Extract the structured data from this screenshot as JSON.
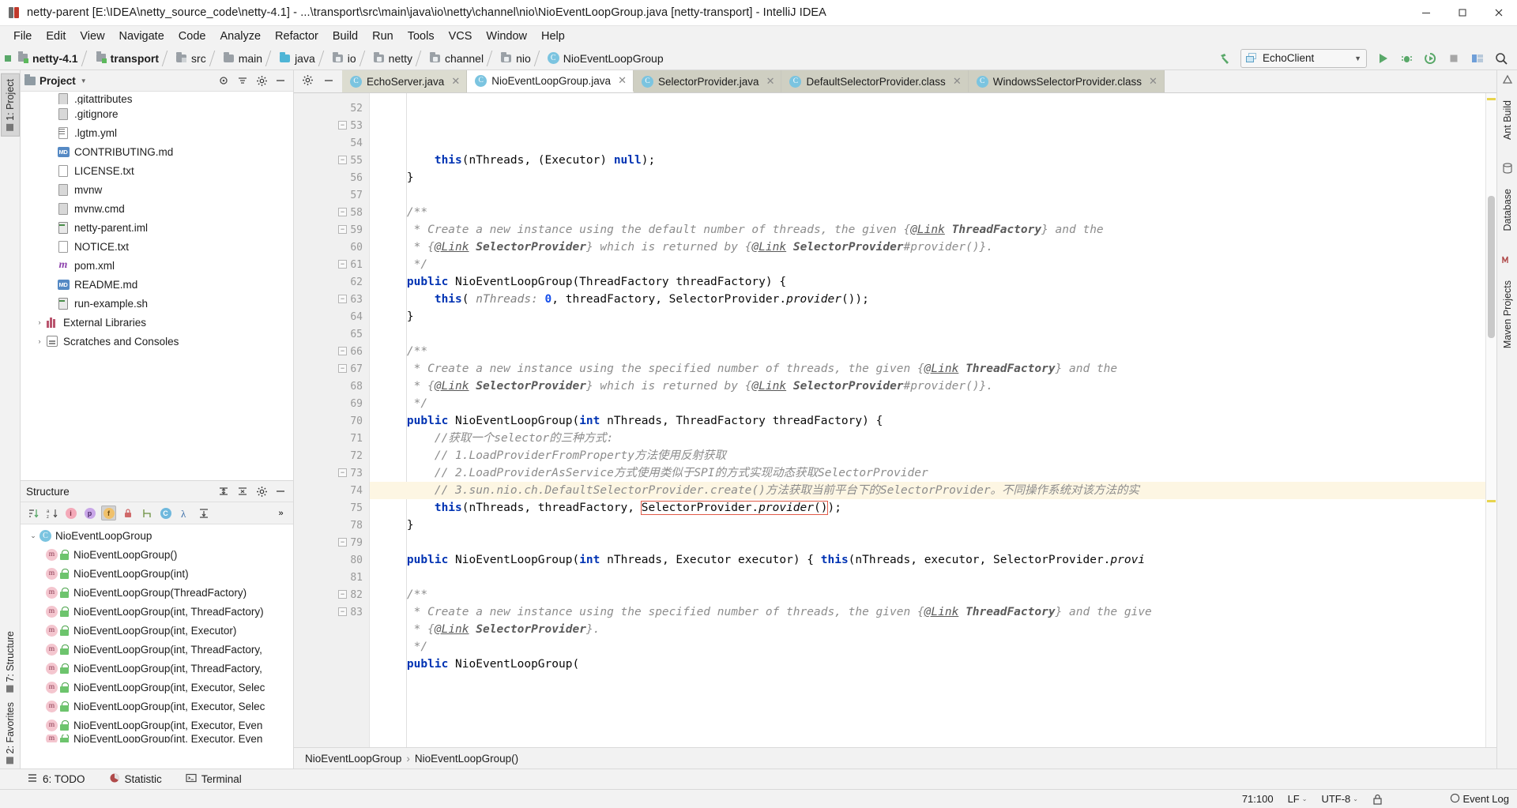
{
  "window": {
    "title": "netty-parent [E:\\IDEA\\netty_source_code\\netty-4.1] - ...\\transport\\src\\main\\java\\io\\netty\\channel\\nio\\NioEventLoopGroup.java [netty-transport] - IntelliJ IDEA",
    "minimize": "minimize-button",
    "maximize": "maximize-button",
    "close": "close-button"
  },
  "menu": [
    "File",
    "Edit",
    "View",
    "Navigate",
    "Code",
    "Analyze",
    "Refactor",
    "Build",
    "Run",
    "Tools",
    "VCS",
    "Window",
    "Help"
  ],
  "breadcrumbs": [
    {
      "label": "netty-4.1",
      "icon": "module-icon",
      "bold": true
    },
    {
      "label": "transport",
      "icon": "module-icon",
      "bold": true
    },
    {
      "label": "src",
      "icon": "folder-src-icon",
      "bold": false
    },
    {
      "label": "main",
      "icon": "folder-icon",
      "bold": false
    },
    {
      "label": "java",
      "icon": "folder-source-root-icon",
      "bold": false
    },
    {
      "label": "io",
      "icon": "folder-package-icon",
      "bold": false
    },
    {
      "label": "netty",
      "icon": "folder-package-icon",
      "bold": false
    },
    {
      "label": "channel",
      "icon": "folder-package-icon",
      "bold": false
    },
    {
      "label": "nio",
      "icon": "folder-package-icon",
      "bold": false
    },
    {
      "label": "NioEventLoopGroup",
      "icon": "class-icon",
      "bold": false
    }
  ],
  "toolbar": {
    "build_hammer": "build-icon",
    "run_config": "EchoClient",
    "run": "run-icon",
    "debug": "debug-icon",
    "run_coverage": "run-with-coverage-icon",
    "stop": "stop-icon",
    "layout": "layout-icon",
    "search": "search-everywhere-icon"
  },
  "project_panel": {
    "title": "Project",
    "collapse_icon": "collapse-all-icon",
    "settings_icon": "gear-icon",
    "hide_icon": "hide-icon",
    "items": [
      {
        "label": ".gitattributes",
        "icon": "file-icon",
        "indent": 1,
        "arrow": ""
      },
      {
        "label": ".gitignore",
        "icon": "file-icon",
        "indent": 1,
        "arrow": ""
      },
      {
        "label": ".lgtm.yml",
        "icon": "yaml-file-icon",
        "indent": 1,
        "arrow": ""
      },
      {
        "label": "CONTRIBUTING.md",
        "icon": "markdown-file-icon",
        "indent": 1,
        "arrow": ""
      },
      {
        "label": "LICENSE.txt",
        "icon": "text-file-icon",
        "indent": 1,
        "arrow": ""
      },
      {
        "label": "mvnw",
        "icon": "file-icon",
        "indent": 1,
        "arrow": ""
      },
      {
        "label": "mvnw.cmd",
        "icon": "file-icon",
        "indent": 1,
        "arrow": ""
      },
      {
        "label": "netty-parent.iml",
        "icon": "iml-file-icon",
        "indent": 1,
        "arrow": ""
      },
      {
        "label": "NOTICE.txt",
        "icon": "text-file-icon",
        "indent": 1,
        "arrow": ""
      },
      {
        "label": "pom.xml",
        "icon": "xml-file-icon",
        "indent": 1,
        "arrow": ""
      },
      {
        "label": "README.md",
        "icon": "markdown-file-icon",
        "indent": 1,
        "arrow": ""
      },
      {
        "label": "run-example.sh",
        "icon": "shell-file-icon",
        "indent": 1,
        "arrow": ""
      },
      {
        "label": "External Libraries",
        "icon": "libraries-icon",
        "indent": 0,
        "arrow": "›"
      },
      {
        "label": "Scratches and Consoles",
        "icon": "scratches-icon",
        "indent": 0,
        "arrow": "›"
      }
    ]
  },
  "structure_panel": {
    "title": "Structure",
    "toolbar_icons": [
      "sort-by-visibility-icon",
      "sort-alphabetically-icon",
      "show-inherited-icon",
      "show-properties-icon",
      "show-fields-icon",
      "show-non-public-icon",
      "group-by-icon",
      "show-anonymous-icon",
      "show-lambdas-icon",
      "expand-all-icon",
      "more-icon"
    ],
    "items": [
      {
        "label": "NioEventLoopGroup",
        "kind": "class",
        "indent": 0,
        "arrow": "⌄"
      },
      {
        "label": "NioEventLoopGroup()",
        "kind": "method",
        "indent": 1,
        "arrow": ""
      },
      {
        "label": "NioEventLoopGroup(int)",
        "kind": "method",
        "indent": 1,
        "arrow": ""
      },
      {
        "label": "NioEventLoopGroup(ThreadFactory)",
        "kind": "method",
        "indent": 1,
        "arrow": ""
      },
      {
        "label": "NioEventLoopGroup(int, ThreadFactory)",
        "kind": "method",
        "indent": 1,
        "arrow": ""
      },
      {
        "label": "NioEventLoopGroup(int, Executor)",
        "kind": "method",
        "indent": 1,
        "arrow": ""
      },
      {
        "label": "NioEventLoopGroup(int, ThreadFactory,",
        "kind": "method",
        "indent": 1,
        "arrow": ""
      },
      {
        "label": "NioEventLoopGroup(int, ThreadFactory,",
        "kind": "method",
        "indent": 1,
        "arrow": ""
      },
      {
        "label": "NioEventLoopGroup(int, Executor, Selec",
        "kind": "method",
        "indent": 1,
        "arrow": ""
      },
      {
        "label": "NioEventLoopGroup(int, Executor, Selec",
        "kind": "method",
        "indent": 1,
        "arrow": ""
      },
      {
        "label": "NioEventLoopGroup(int, Executor, Even",
        "kind": "method",
        "indent": 1,
        "arrow": ""
      },
      {
        "label": "NioEventLoopGroup(int, Executor, Even",
        "kind": "method",
        "indent": 1,
        "arrow": ""
      }
    ]
  },
  "left_tool_tabs": [
    {
      "label": "1: Project",
      "selected": true
    },
    {
      "label": "7: Structure",
      "selected": false
    },
    {
      "label": "2: Favorites",
      "selected": false
    }
  ],
  "right_tool_tabs": [
    {
      "label": "Ant Build"
    },
    {
      "label": "Database"
    },
    {
      "label": "Maven Projects"
    }
  ],
  "editor_tabs": [
    {
      "label": "EchoServer.java",
      "icon": "java-runnable-class-icon",
      "state": "inactive"
    },
    {
      "label": "NioEventLoopGroup.java",
      "icon": "java-class-icon",
      "state": "active"
    },
    {
      "label": "SelectorProvider.java",
      "icon": "java-class-readonly-icon",
      "state": "inactive"
    },
    {
      "label": "DefaultSelectorProvider.class",
      "icon": "java-class-file-icon",
      "state": "inactive"
    },
    {
      "label": "WindowsSelectorProvider.class",
      "icon": "java-class-file-icon",
      "state": "inactive"
    }
  ],
  "editor": {
    "first_line": 52,
    "highlight_line": 71,
    "lines": [
      {
        "n": 52,
        "fold": "",
        "html": "        <span class='kw'>this</span>(nThreads, (Executor) <span class='kw'>null</span>);"
      },
      {
        "n": 53,
        "fold": "-",
        "html": "    }"
      },
      {
        "n": 54,
        "fold": "",
        "html": ""
      },
      {
        "n": 55,
        "fold": "+",
        "html": "    <span class='cmt'>/**</span>"
      },
      {
        "n": 56,
        "fold": "",
        "html": "     <span class='cmt'>* Create a new instance using the default number of threads, the given </span><span class='cmt'>{</span><span class='lnk'>@Link</span><span class='cmt'> </span><span class='cmt-b'>ThreadFactory</span><span class='cmt'>} and the</span>"
      },
      {
        "n": 57,
        "fold": "",
        "html": "     <span class='cmt'>* </span><span class='cmt'>{</span><span class='lnk'>@Link</span><span class='cmt'> </span><span class='cmt-b'>SelectorProvider</span><span class='cmt'>} which is returned by </span><span class='cmt'>{</span><span class='lnk'>@Link</span><span class='cmt'> </span><span class='cmt-b'>SelectorProvider</span><span class='cmt'>#provider()}.</span>"
      },
      {
        "n": 58,
        "fold": "-",
        "html": "     <span class='cmt'>*/</span>"
      },
      {
        "n": 59,
        "fold": "+",
        "html": "    <span class='kw'>public</span> NioEventLoopGroup(ThreadFactory threadFactory) {"
      },
      {
        "n": 60,
        "fold": "",
        "html": "        <span class='kw'>this</span>( <span class='param'>nThreads:</span> <span class='num'>0</span>, threadFactory, SelectorProvider.<span class='ital'>provider</span>());"
      },
      {
        "n": 61,
        "fold": "-",
        "html": "    }"
      },
      {
        "n": 62,
        "fold": "",
        "html": ""
      },
      {
        "n": 63,
        "fold": "+",
        "html": "    <span class='cmt'>/**</span>"
      },
      {
        "n": 64,
        "fold": "",
        "html": "     <span class='cmt'>* Create a new instance using the specified number of threads, the given </span><span class='cmt'>{</span><span class='lnk'>@Link</span><span class='cmt'> </span><span class='cmt-b'>ThreadFactory</span><span class='cmt'>} and the</span>"
      },
      {
        "n": 65,
        "fold": "",
        "html": "     <span class='cmt'>* </span><span class='cmt'>{</span><span class='lnk'>@Link</span><span class='cmt'> </span><span class='cmt-b'>SelectorProvider</span><span class='cmt'>} which is returned by </span><span class='cmt'>{</span><span class='lnk'>@Link</span><span class='cmt'> </span><span class='cmt-b'>SelectorProvider</span><span class='cmt'>#provider()}.</span>"
      },
      {
        "n": 66,
        "fold": "-",
        "html": "     <span class='cmt'>*/</span>"
      },
      {
        "n": 67,
        "fold": "+",
        "html": "    <span class='kw'>public</span> NioEventLoopGroup(<span class='kw'>int</span> nThreads, ThreadFactory threadFactory) {"
      },
      {
        "n": 68,
        "fold": "",
        "html": "        <span class='cmt'>//获取一个selector的三种方式:</span>"
      },
      {
        "n": 69,
        "fold": "",
        "html": "        <span class='cmt'>// 1.LoadProviderFromProperty方法使用反射获取</span>"
      },
      {
        "n": 70,
        "fold": "",
        "html": "        <span class='cmt'>// 2.LoadProviderAsService方式使用类似于SPI的方式实现动态获取SelectorProvider</span>"
      },
      {
        "n": 71,
        "fold": "",
        "html": "        <span class='cmt'>// 3.sun.nio.ch.DefaultSelectorProvider.create()方法获取当前平台下的SelectorProvider。不同操作系统对该方法的实</span>"
      },
      {
        "n": 72,
        "fold": "",
        "html": "        <span class='kw'>this</span>(nThreads, threadFactory, <span class='boxhl'>SelectorProvider.<span class='ital'>provider</span>()</span>);"
      },
      {
        "n": 73,
        "fold": "-",
        "html": "    }"
      },
      {
        "n": 74,
        "fold": "",
        "html": ""
      },
      {
        "n": 75,
        "fold": "",
        "html": "    <span class='kw'>public</span> NioEventLoopGroup(<span class='kw'>int</span> nThreads, Executor executor) { <span class='kw'>this</span>(nThreads, executor, SelectorProvider.<span class='ital'>provi</span>"
      },
      {
        "n": 78,
        "fold": "",
        "html": ""
      },
      {
        "n": 79,
        "fold": "+",
        "html": "    <span class='cmt'>/**</span>"
      },
      {
        "n": 80,
        "fold": "",
        "html": "     <span class='cmt'>* Create a new instance using the specified number of threads, the given </span><span class='cmt'>{</span><span class='lnk'>@Link</span><span class='cmt'> </span><span class='cmt-b'>ThreadFactory</span><span class='cmt'>} and the give</span>"
      },
      {
        "n": 81,
        "fold": "",
        "html": "     <span class='cmt'>* </span><span class='cmt'>{</span><span class='lnk'>@Link</span><span class='cmt'> </span><span class='cmt-b'>SelectorProvider</span><span class='cmt'>}.</span>"
      },
      {
        "n": 82,
        "fold": "-",
        "html": "     <span class='cmt'>*/</span>"
      },
      {
        "n": 83,
        "fold": "+",
        "html": "    <span class='kw'>public</span> NioEventLoopGroup("
      }
    ]
  },
  "editor_breadcrumb": {
    "class": "NioEventLoopGroup",
    "separator": "›",
    "member": "NioEventLoopGroup()"
  },
  "bottom_tools": [
    {
      "label": "6: TODO",
      "icon": "todo-icon"
    },
    {
      "label": "Statistic",
      "icon": "statistic-icon"
    },
    {
      "label": "Terminal",
      "icon": "terminal-icon"
    }
  ],
  "status_bar": {
    "position": "71:100",
    "line_separator": "LF",
    "encoding": "UTF-8",
    "event_log": "Event Log",
    "chev": "⌄"
  },
  "colors": {
    "accent_blue": "#0033b3",
    "comment_gray": "#8c8c8c",
    "highlight_bg": "#fdf6e3",
    "box_outline": "#e05b49",
    "tab_active": "#ffffff",
    "tab_inactive": "#dcdcd0",
    "panel_bg": "#f2f2f2"
  }
}
